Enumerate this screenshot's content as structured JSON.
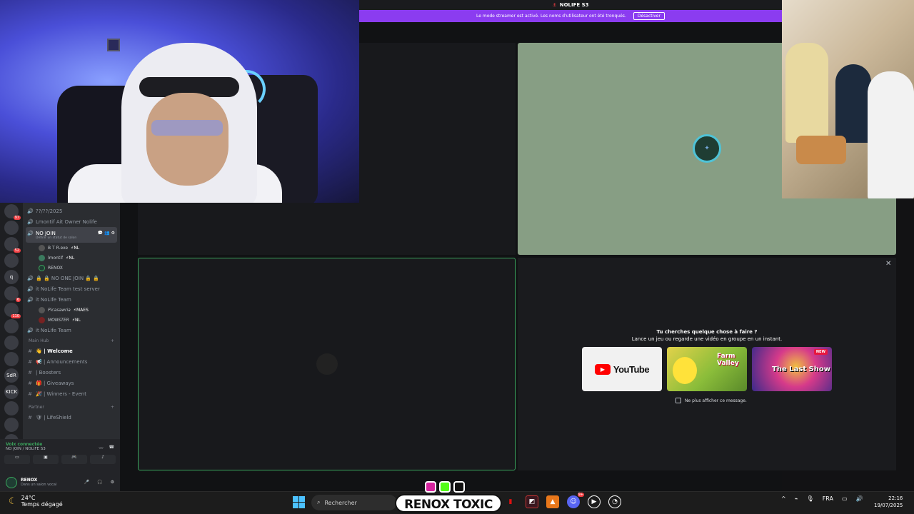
{
  "topbar": {
    "server_title": "NOLIFE S3"
  },
  "streamer_banner": {
    "message": "Le mode streamer est activé. Les noms d'utilisateur ont été tronqués.",
    "button": "Désactiver"
  },
  "guilds": [
    {
      "label": "",
      "badge": "97"
    },
    {
      "label": "",
      "badge": ""
    },
    {
      "label": "",
      "badge": "52"
    },
    {
      "label": "",
      "badge": ""
    },
    {
      "label": "q",
      "badge": ""
    },
    {
      "label": "",
      "badge": "6"
    },
    {
      "label": "",
      "badge": "110"
    },
    {
      "label": "",
      "badge": ""
    },
    {
      "label": "",
      "badge": ""
    },
    {
      "label": "",
      "badge": ""
    },
    {
      "label": "SdR",
      "badge": ""
    },
    {
      "label": "KICK",
      "badge": ""
    },
    {
      "label": "",
      "badge": ""
    },
    {
      "label": "",
      "badge": ""
    },
    {
      "label": "",
      "badge": "NOUVEAU"
    }
  ],
  "channels": {
    "voice": [
      {
        "name": "??/??/2025"
      },
      {
        "name": "Lmontif Ait Owner Nolife"
      }
    ],
    "current": {
      "name": "NO JOIN",
      "status": "Définir un statut de salon"
    },
    "members": [
      {
        "name": "B T R.exe",
        "tag": "⚡NL"
      },
      {
        "name": "lmontif",
        "tag": "⚡NL"
      },
      {
        "name": "RENOX",
        "tag": ""
      }
    ],
    "locked": [
      {
        "name": "🔒 🔒 NO ONE JOIN 🔒 🔒"
      },
      {
        "name": "it NoLife Team test server"
      },
      {
        "name": "it NoLife Team"
      }
    ],
    "team_members": [
      {
        "name": "Picasawria",
        "tag": "⚡MAES"
      },
      {
        "name": "MONSTER",
        "tag": "⚡NL"
      }
    ],
    "last_voice": {
      "name": "it NoLife Team"
    },
    "main_hub_label": "Main Hub",
    "text": [
      {
        "name": "👋 | Welcome",
        "active": true
      },
      {
        "name": "📢 | Announcements"
      },
      {
        "name": "| Boosters"
      },
      {
        "name": "🎁 | Giveaways"
      },
      {
        "name": "🎉 | Winners - Event"
      }
    ],
    "partner_label": "Partner",
    "partner": [
      {
        "name": "🛡 | LifeShield"
      }
    ]
  },
  "voice_panel": {
    "status": "Voix connectée",
    "location": "NO JOIN / NOLIFE S3"
  },
  "user_panel": {
    "name": "RENOX",
    "status": "Dans un salon vocal"
  },
  "activity": {
    "title": "Tu cherches quelque chose à faire ?",
    "subtitle": "Lance un jeu ou regarde une vidéo en groupe en un instant.",
    "cards": [
      {
        "name": "YouTube"
      },
      {
        "name": "Farm Valley"
      },
      {
        "name": "The Last Show",
        "badge": "NEW"
      }
    ],
    "dont_show": "Ne plus afficher ce message."
  },
  "taskbar": {
    "weather_temp": "24°C",
    "weather_desc": "Temps dégagé",
    "search_placeholder": "Rechercher",
    "language": "FRA",
    "time": "22:16",
    "date": "19/07/2025",
    "discord_badge": "9+"
  },
  "watermark": {
    "text": "RENOX TOXIC"
  },
  "colors": {
    "accent": "#8b3cf0",
    "speaking": "#3ba55d",
    "tile": "#879e84"
  }
}
